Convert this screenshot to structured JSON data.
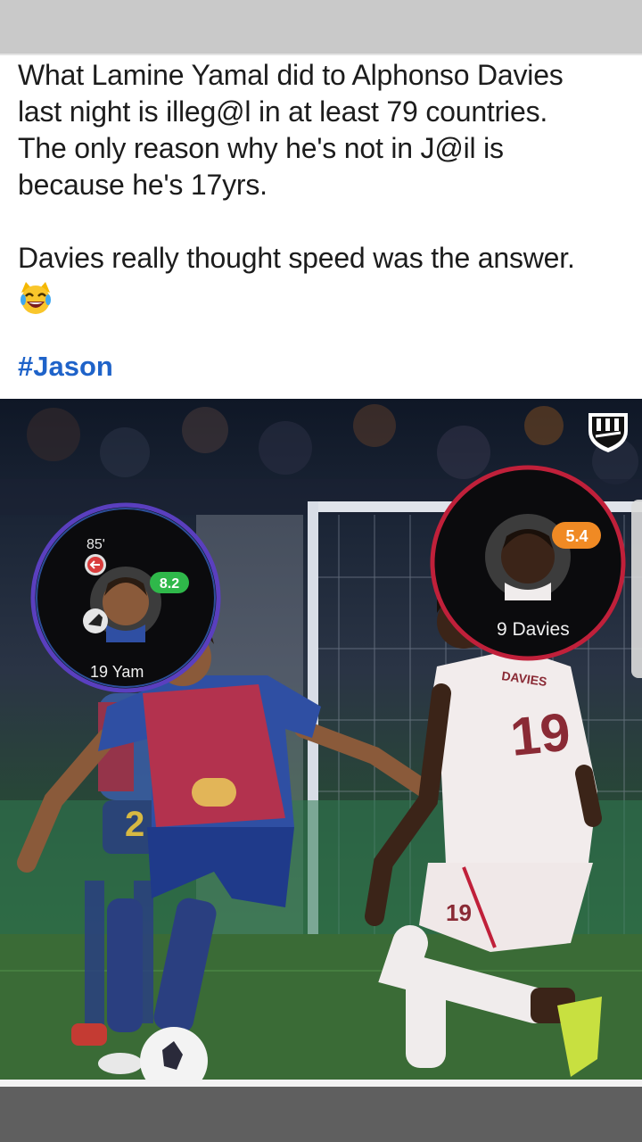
{
  "post": {
    "line1": "What Lamine Yamal did to Alphonso Davies",
    "line2": "last night is illeg@l in at least 79 countries.",
    "line3": "The only reason why he's not in J@il is",
    "line4": "because he's 17yrs.",
    "line5": "Davies really thought speed was the answer.",
    "emoji": "laughing-crying-cat",
    "hashtag": "#Jason"
  },
  "image": {
    "yamal_card": {
      "minute": "85'",
      "rating": "8.2",
      "label": "19 Yam",
      "rating_color": "#2fb84a",
      "ring_color": "#5a3fbf"
    },
    "davies_card": {
      "rating": "5.4",
      "label": "9 Davies",
      "rating_color": "#f08a24",
      "ring_color": "#c0203a"
    },
    "yamal_shirt_number": "2",
    "davies_shirt_number": "19",
    "davies_shirt_name": "DAVIES",
    "davies_shorts_number": "19",
    "brand_logo": "barca-crest-logo"
  }
}
